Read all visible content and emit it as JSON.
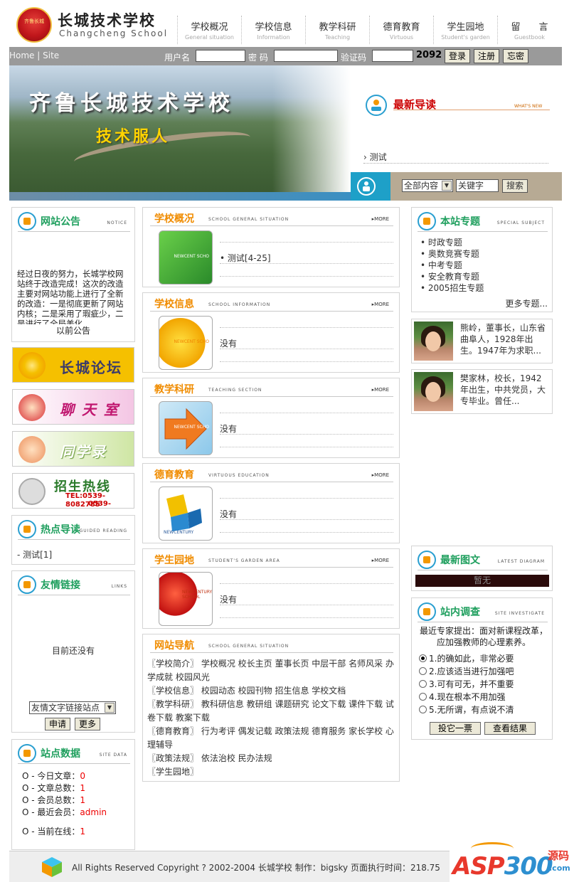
{
  "header": {
    "logo_cn": "长城技术学校",
    "logo_en": "Changcheng School",
    "seal_text": "齐鲁长城",
    "nav": [
      {
        "cn": "学校概况",
        "en": "General situation"
      },
      {
        "cn": "学校信息",
        "en": "Information"
      },
      {
        "cn": "教学科研",
        "en": "Teaching"
      },
      {
        "cn": "德育教育",
        "en": "Virtuous"
      },
      {
        "cn": "学生园地",
        "en": "Student's garden"
      },
      {
        "cn": "留　　言",
        "en": "Guestbook"
      }
    ]
  },
  "loginbar": {
    "home": "Home",
    "sep": "|",
    "site": "Site",
    "username_label": "用户名",
    "password_label": "密 码",
    "vcode_label": "验证码",
    "vcode_value": "2092",
    "login_btn": "登录",
    "register_btn": "注册",
    "forgot_btn": "忘密"
  },
  "banner": {
    "title": "齐鲁长城技术学校",
    "slogan": "技术服人",
    "whatsnew_title": "最新导读",
    "whatsnew_en": "WHAT'S NEW",
    "whatsnew_item": "测试",
    "search_scope": "全部内容",
    "search_placeholder": "关键字",
    "search_btn": "搜索"
  },
  "notice": {
    "title": "网站公告",
    "en": "NOTICE",
    "text": "经过日夜的努力，长城学校网站终于改造完成！这次的改造主要对网站功能上进行了全新的改造：一是彻底更新了网站内核；二是采用了瑕疵少，二是进行了全局美化",
    "prev": "以前公告"
  },
  "banners": [
    {
      "text": "长城论坛",
      "color": "#f5c000",
      "text_color": "#3b3b6b"
    },
    {
      "text": "聊 天 室",
      "color": "#f4c6e4",
      "text_color": "#c0166f"
    },
    {
      "text": "同学录",
      "color": "#cfe6a4",
      "text_color": "#fff"
    },
    {
      "text": "招生热线",
      "color": "#ffffff",
      "text_color": "#2a7a2a",
      "sub1": "TEL:0539-8082785",
      "sub2": "0539-8082787"
    }
  ],
  "hot": {
    "title": "热点导读",
    "en": "GUIDED READING",
    "item": "- 测试[1]"
  },
  "links": {
    "title": "友情链接",
    "en": "LINKS",
    "empty": "目前还没有",
    "select": "友情文字链接站点",
    "apply_btn": "申请",
    "more_btn": "更多"
  },
  "stats": {
    "title": "站点数据",
    "en": "SITE DATA",
    "rows": [
      {
        "label": "O - 今日文章：",
        "value": "0"
      },
      {
        "label": "O - 文章总数：",
        "value": "1"
      },
      {
        "label": "O - 会员总数：",
        "value": "1"
      },
      {
        "label": "O - 最近会员：",
        "value": "admin"
      },
      {
        "label": "O - 当前在线：",
        "value": "1"
      }
    ]
  },
  "sections": [
    {
      "cn": "学校概况",
      "en": "SCHOOL GENERAL SITUATION",
      "item": "测试[4-25]",
      "thumb_label": "NEWCENT SCHO",
      "color": "#3bb33b"
    },
    {
      "cn": "学校信息",
      "en": "SCHOOL INFORMATION",
      "item": "没有",
      "thumb_label": "NEWCENT SCHO",
      "color": "#f2b500"
    },
    {
      "cn": "教学科研",
      "en": "TEACHING SECTION",
      "item": "没有",
      "thumb_label": "NEWCENT SCHO",
      "color": "#f07a20"
    },
    {
      "cn": "德育教育",
      "en": "VIRTUOUS EDUCATION",
      "item": "没有",
      "thumb_label": "NEWCENTURY",
      "color": "#2a8ad0"
    },
    {
      "cn": "学生园地",
      "en": "STUDENT'S GARDEN AREA",
      "item": "没有",
      "thumb_label": "NEWCENTURY SCHOOL",
      "color": "#e03020"
    }
  ],
  "more_label": "MORE",
  "sitenav": {
    "title": "网站导航",
    "en": "SCHOOL GENERAL SITUATION",
    "lines": [
      "〖学校简介〗 学校概况 校长主页 董事长页 中层干部 名师风采 办学成就 校园风光",
      "〖学校信息〗 校园动态 校园刊物 招生信息 学校文档",
      "〖教学科研〗 教科研信息 教研组 课题研究 论文下载 课件下载 试卷下载 教案下载",
      "〖德育教育〗 行为考评 偶发记载 政策法规 德育服务 家长学校 心理辅导",
      "〖政策法规〗 依法治校 民办法规",
      "〖学生园地〗"
    ]
  },
  "topics": {
    "title": "本站专题",
    "en": "SPECIAL SUBJECT",
    "items": [
      "• 时政专题",
      "• 奥数竞赛专题",
      "• 中考专题",
      "• 安全教育专题",
      "• 2005招生专题"
    ],
    "more": "更多专题..."
  },
  "people": [
    {
      "desc": "熊岭，董事长，山东省曲阜人，1928年出生。1947年为求职..."
    },
    {
      "desc": "樊家林，校长，1942年出生，中共党员，大专毕业。曾任..."
    }
  ],
  "latest": {
    "title": "最新图文",
    "en": "LATEST DIAGRAM",
    "empty": "暂无"
  },
  "survey": {
    "title": "站内调查",
    "en": "SITE INVESTIGATE",
    "question": "最近专家提出：面对新课程改革，应加强教师的心理素养。",
    "options": [
      "1.的确如此，非常必要",
      "2.应该适当进行加强吧",
      "3.可有可无，并不重要",
      "4.现在根本不用加强",
      "5.无所谓，有点说不清"
    ],
    "selected": 0,
    "vote_btn": "投它一票",
    "result_btn": "查看结果"
  },
  "footer": {
    "text": "All Rights Reserved Copyright ? 2002-2004 长城学校 制作：bigsky 页面执行时间：218.75"
  },
  "watermark": {
    "a": "ASP",
    "b": "300",
    "cn": "源码",
    "com": ".com"
  }
}
